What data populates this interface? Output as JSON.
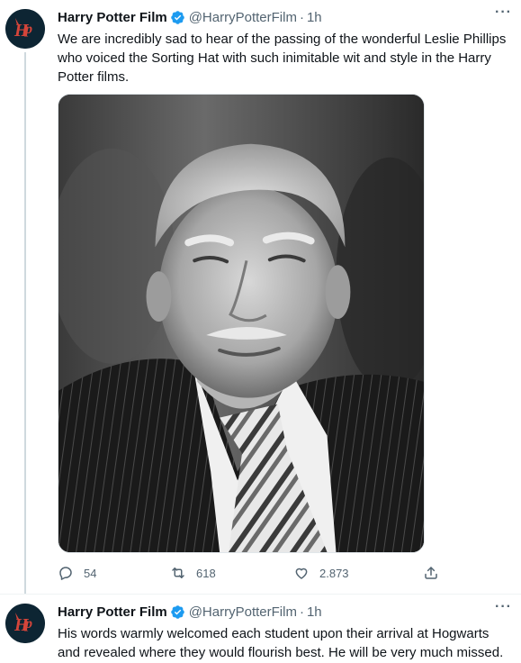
{
  "colors": {
    "text": "#0f1419",
    "secondary": "#536471",
    "verified": "#1d9bf0",
    "avatar_bg": "#0d2533",
    "avatar_logo": "#c0392b"
  },
  "tweets": [
    {
      "display_name": "Harry Potter Film",
      "handle": "@HarryPotterFilm",
      "separator": "·",
      "time": "1h",
      "more": "···",
      "text": "We are incredibly sad to hear of the passing of the wonderful Leslie Phillips who voiced the Sorting Hat with such inimitable wit and style in the Harry Potter films.",
      "media": "black-and-white portrait photo",
      "replies": "54",
      "retweets": "618",
      "likes": "2.873"
    },
    {
      "display_name": "Harry Potter Film",
      "handle": "@HarryPotterFilm",
      "separator": "·",
      "time": "1h",
      "more": "···",
      "text": "His words warmly welcomed each student upon their arrival at Hogwarts and revealed where they would flourish best. He will be very much missed."
    }
  ],
  "icons": {
    "avatar": "hp-logo-icon",
    "verified": "verified-badge-icon",
    "reply": "reply-icon",
    "retweet": "retweet-icon",
    "like": "heart-icon",
    "share": "share-icon",
    "more": "more-icon"
  }
}
